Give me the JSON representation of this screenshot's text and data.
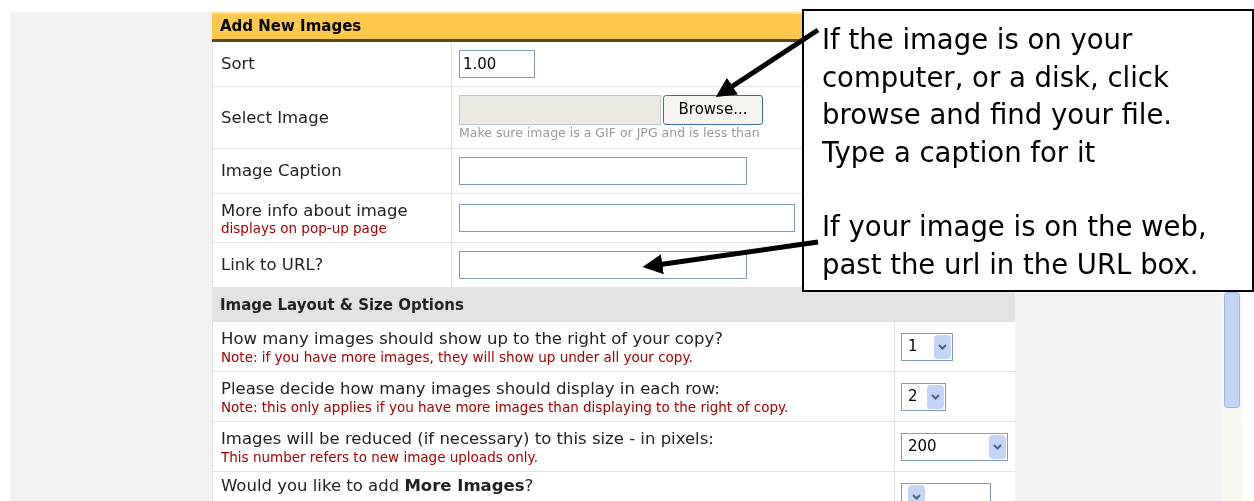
{
  "add_images": {
    "title": "Add New Images",
    "rows": [
      {
        "kind": "text",
        "label": "Sort",
        "value": "1.00"
      },
      {
        "kind": "file",
        "label": "Select Image",
        "button": "Browse...",
        "hint": "Make sure image is a GIF or JPG and is less than"
      },
      {
        "kind": "text",
        "label": "Image Caption"
      },
      {
        "kind": "text",
        "label": "More info about image",
        "note": "displays on pop-up page"
      },
      {
        "kind": "text",
        "label": "Link to URL?"
      }
    ]
  },
  "layout_options": {
    "title": "Image Layout & Size Options",
    "rows": [
      {
        "question": "How many images should show up to the right of your copy?",
        "note": "Note: if you have more images, they will show up under all your copy.",
        "value": "1"
      },
      {
        "question": "Please decide how many images should display in each row:",
        "note": "Note: this only applies if you have more images than displaying to the right of copy.",
        "value": "2"
      },
      {
        "question": "Images will be reduced (if necessary) to this size - in pixels:",
        "note": "This number refers to new image uploads only.",
        "value": "200"
      },
      {
        "question": "Would you like to add **More Images**?"
      }
    ]
  },
  "callout": {
    "paragraphs": [
      {
        "lines": [
          "If the image is on your",
          "computer, or a disk, click",
          "browse and find your file.",
          "Type a caption for it"
        ]
      },
      {
        "lines": [
          "If your image is on the web,",
          "past the url in the URL box."
        ]
      }
    ]
  }
}
